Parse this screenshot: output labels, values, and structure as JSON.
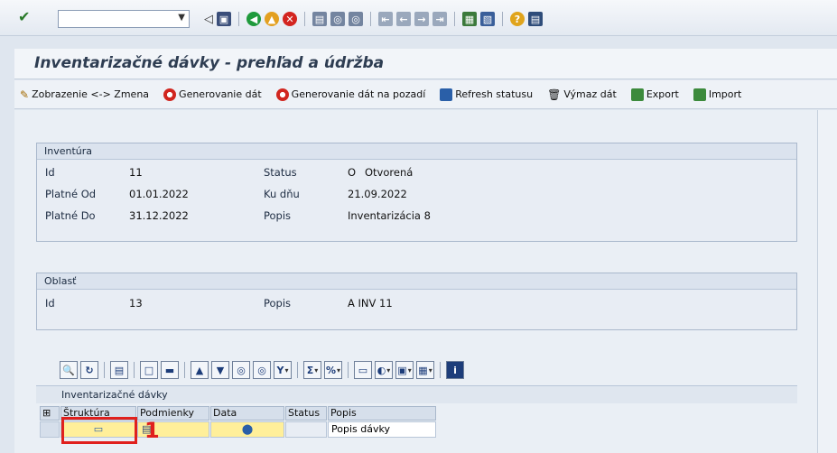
{
  "window": {
    "title": "Inventarizačné dávky - prehľad a údržba"
  },
  "toolbar": {
    "items": [
      {
        "label": "Zobrazenie <-> Zmena",
        "icon": "glasses-pencil-icon"
      },
      {
        "label": "Generovanie dát",
        "icon": "execute-icon"
      },
      {
        "label": "Generovanie dát na pozadí",
        "icon": "background-execute-icon"
      },
      {
        "label": "Refresh statusu",
        "icon": "refresh-icon"
      },
      {
        "label": "Výmaz dát",
        "icon": "trash-icon"
      },
      {
        "label": "Export",
        "icon": "export-icon"
      },
      {
        "label": "Import",
        "icon": "import-icon"
      }
    ]
  },
  "inventura": {
    "header": "Inventúra",
    "id_label": "Id",
    "id_value": "11",
    "from_label": "Platné Od",
    "from_value": "01.01.2022",
    "to_label": "Platné Do",
    "to_value": "31.12.2022",
    "status_label": "Status",
    "status_code": "O",
    "status_value": "Otvorená",
    "kudnu_label": "Ku dňu",
    "kudnu_value": "21.09.2022",
    "popis_label": "Popis",
    "popis_value": "Inventarizácia 8"
  },
  "oblast": {
    "header": "Oblasť",
    "id_label": "Id",
    "id_value": "13",
    "popis_label": "Popis",
    "popis_value": "A INV 11"
  },
  "alv": {
    "title": "Inventarizačné dávky",
    "columns": [
      "Štruktúra",
      "Podmienky",
      "Data",
      "Status",
      "Popis"
    ],
    "row": {
      "popis": "Popis dávky"
    }
  },
  "annotation": {
    "number": "1"
  },
  "colors": {
    "highlight_red": "#e0201d",
    "title_color": "#2e3d52",
    "cell_yellow": "#ffef9a"
  }
}
